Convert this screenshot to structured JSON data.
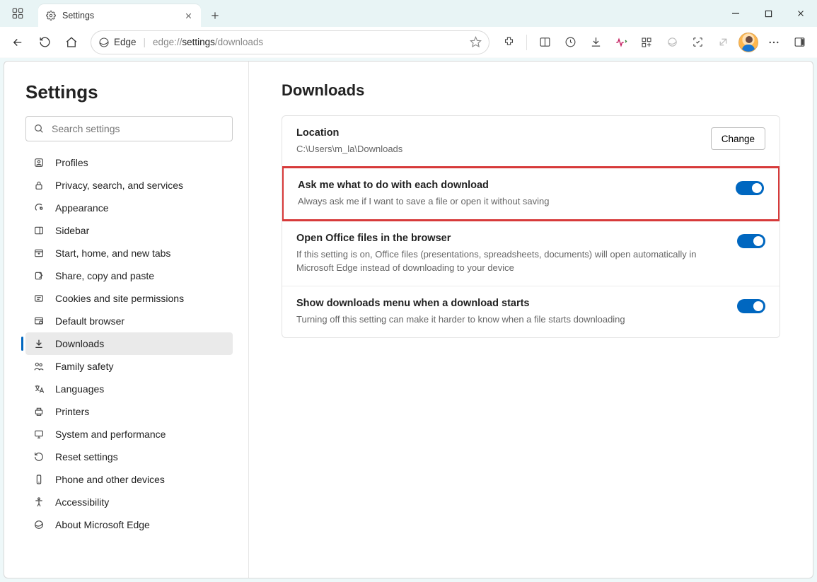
{
  "tab": {
    "title": "Settings"
  },
  "address": {
    "chip": "Edge",
    "url_prefix": "edge://",
    "url_bold": "settings",
    "url_suffix": "/downloads"
  },
  "sidebar": {
    "title": "Settings",
    "search_placeholder": "Search settings",
    "items": [
      {
        "label": "Profiles"
      },
      {
        "label": "Privacy, search, and services"
      },
      {
        "label": "Appearance"
      },
      {
        "label": "Sidebar"
      },
      {
        "label": "Start, home, and new tabs"
      },
      {
        "label": "Share, copy and paste"
      },
      {
        "label": "Cookies and site permissions"
      },
      {
        "label": "Default browser"
      },
      {
        "label": "Downloads"
      },
      {
        "label": "Family safety"
      },
      {
        "label": "Languages"
      },
      {
        "label": "Printers"
      },
      {
        "label": "System and performance"
      },
      {
        "label": "Reset settings"
      },
      {
        "label": "Phone and other devices"
      },
      {
        "label": "Accessibility"
      },
      {
        "label": "About Microsoft Edge"
      }
    ]
  },
  "main": {
    "heading": "Downloads",
    "location": {
      "title": "Location",
      "path": "C:\\Users\\m_la\\Downloads",
      "change": "Change"
    },
    "ask": {
      "title": "Ask me what to do with each download",
      "desc": "Always ask me if I want to save a file or open it without saving"
    },
    "office": {
      "title": "Open Office files in the browser",
      "desc": "If this setting is on, Office files (presentations, spreadsheets, documents) will open automatically in Microsoft Edge instead of downloading to your device"
    },
    "showmenu": {
      "title": "Show downloads menu when a download starts",
      "desc": "Turning off this setting can make it harder to know when a file starts downloading"
    }
  }
}
